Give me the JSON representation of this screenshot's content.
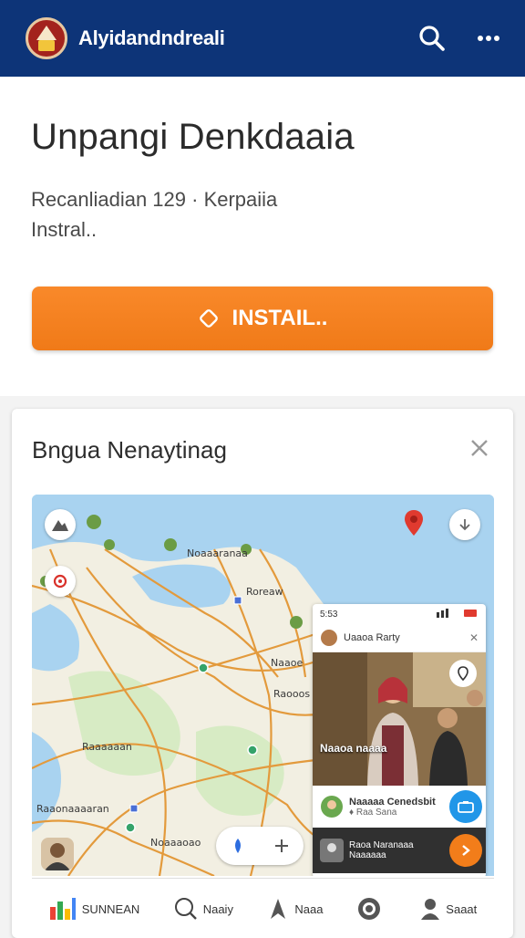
{
  "appbar": {
    "title": "Alyidandndreali",
    "icons": [
      "app-logo",
      "search-icon",
      "more-icon"
    ]
  },
  "app": {
    "name": "Unpangi Denkdaaia",
    "meta_line1": "Recanliadian 129 · Kerpaiia",
    "meta_line2": "Instral..",
    "install_label": "INSTAIL..",
    "install_color": "#f28320"
  },
  "preview": {
    "title": "Bngua Nenaytinag",
    "close_icon": "close-icon",
    "map": {
      "labels": [
        "Noaaaranaa",
        "Roreaw",
        "Raaaaaan",
        "Naaoe",
        "Raooos",
        "Raaonaaaaran",
        "Noaaaoao"
      ]
    },
    "social_card": {
      "time": "5:53",
      "profile_name": "Uaaoa Rarty",
      "photo_caption": "Naaoa naaaa",
      "post_name": "Naaaaa Cenedsbit",
      "post_sub": "♦ Raa Sana",
      "post2_text": "Raoa Naranaaa Naaaaaa"
    },
    "nav": [
      {
        "label": "SUNNEAN",
        "icon": "chart-icon"
      },
      {
        "label": "Naaiy",
        "icon": "search-icon"
      },
      {
        "label": "Naaa",
        "icon": "pin-icon"
      },
      {
        "label": "",
        "icon": "globe-icon"
      },
      {
        "label": "Saaat",
        "icon": "person-icon"
      }
    ]
  },
  "colors": {
    "appbar": "#0d3478",
    "install": "#f28320",
    "map_water": "#a9d3f0",
    "map_land": "#f2efe2",
    "roads": "#e39a3c"
  }
}
